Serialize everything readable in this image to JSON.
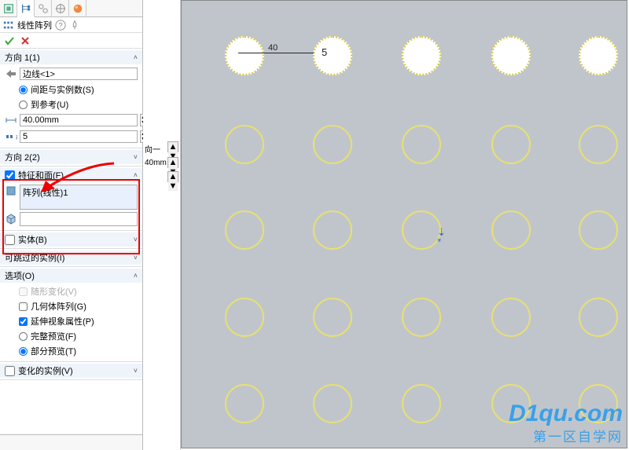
{
  "tabs": [
    "feature",
    "tree",
    "config",
    "target",
    "appearance"
  ],
  "title": "线性阵列",
  "sections": {
    "dir1": {
      "label": "方向 1(1)",
      "edge": "边线<1>",
      "opt_spacing": "间距与实例数(S)",
      "opt_ref": "到参考(U)",
      "spacing": "40.00mm",
      "count": "5"
    },
    "dir2": {
      "label": "方向 2(2)"
    },
    "feat": {
      "label": "特征和面(F)",
      "item": "阵列(线性)1"
    },
    "body": {
      "label": "实体(B)"
    },
    "skip": {
      "label": "可跳过的实例(I)"
    },
    "opts": {
      "label": "选项(O)",
      "vary": "随形变化(V)",
      "geom": "几何体阵列(G)",
      "prop": "延伸视象属性(P)",
      "full": "完整预览(F)",
      "partial": "部分预览(T)"
    },
    "vary_inst": {
      "label": "变化的实例(V)"
    }
  },
  "sidestrip": {
    "label1": "向一",
    "label2": "40mm"
  },
  "viewport": {
    "dim_val": "40",
    "dim_count": "5",
    "rows": [
      45,
      158,
      267,
      378,
      488
    ],
    "cols": [
      55,
      167,
      280,
      394,
      505
    ]
  },
  "watermark": {
    "line1": "D1qu.com",
    "line2": "第一区自学网"
  }
}
